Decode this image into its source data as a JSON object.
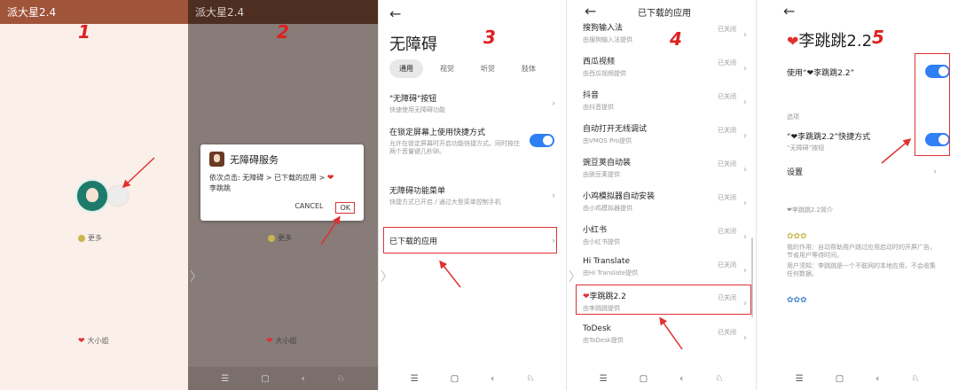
{
  "colors": {
    "accent": "#e03030",
    "switch": "#2f7ff5",
    "panel1_bar": "#a0543a",
    "panel2_bar": "#4d2e21"
  },
  "p1": {
    "step": "1",
    "app_title": "派大星2.4",
    "more": "更多",
    "footer": "大小姐"
  },
  "p2": {
    "step": "2",
    "app_title": "派大星2.4",
    "more": "更多",
    "footer": "大小姐",
    "dialog": {
      "title": "无障碍服务",
      "body_line1": "依次点击: 无障碍 > 已下载的应用 >",
      "body_line2": "李跳跳",
      "cancel": "CANCEL",
      "ok": "OK"
    },
    "nav": [
      "☰",
      "▢",
      "‹",
      "♘"
    ]
  },
  "p3": {
    "step": "3",
    "back": "←",
    "title": "无障碍",
    "tabs": [
      "通用",
      "视觉",
      "听觉",
      "肢体"
    ],
    "rows": [
      {
        "title": "\"无障碍\"按钮",
        "sub": "快速使用无障碍功能"
      },
      {
        "title": "在锁定屏幕上使用快捷方式",
        "sub": "允许在锁定屏幕时开启功能快捷方式。同时按住两个音量键几秒钟。"
      },
      {
        "title": "无障碍功能菜单",
        "sub": "快捷方式已开启 / 通过大型菜单控制手机"
      },
      {
        "title": "已下载的应用",
        "sub": ""
      }
    ],
    "nav": [
      "☰",
      "▢",
      "‹",
      "♘"
    ]
  },
  "p4": {
    "step": "4",
    "back": "←",
    "title": "已下载的应用",
    "apps": [
      {
        "name": "搜狗输入法",
        "sub": "由搜狗输入法提供",
        "status": "已关闭"
      },
      {
        "name": "西瓜视频",
        "sub": "由西瓜视频提供",
        "status": "已关闭"
      },
      {
        "name": "抖音",
        "sub": "由抖音提供",
        "status": "已关闭"
      },
      {
        "name": "自动打开无线调试",
        "sub": "由VMOS Pro提供",
        "status": "已关闭"
      },
      {
        "name": "豌豆荚自动装",
        "sub": "由豌豆荚提供",
        "status": "已关闭"
      },
      {
        "name": "小鸡模拟器自动安装",
        "sub": "由小鸡模拟器提供",
        "status": "已关闭"
      },
      {
        "name": "小红书",
        "sub": "由小红书提供",
        "status": "已关闭"
      },
      {
        "name": "Hi Translate",
        "sub": "由Hi Translate提供",
        "status": "已关闭"
      },
      {
        "name": "李跳跳2.2",
        "sub": "由李跳跳提供",
        "status": "已关闭"
      },
      {
        "name": "ToDesk",
        "sub": "由ToDesk提供",
        "status": "已关闭"
      }
    ],
    "nav": [
      "☰",
      "▢",
      "‹",
      "♘"
    ]
  },
  "p5": {
    "step": "5",
    "back": "←",
    "title": "李跳跳2.2",
    "use_label": "使用“❤李跳跳2.2”",
    "section": "选项",
    "shortcut_label": "“❤李跳跳2.2”快捷方式",
    "shortcut_sub": "“无障碍”按钮",
    "settings": "设置",
    "help_title": "❤李跳跳2.2简介",
    "help_lines": [
      "我的作用：自动帮助用户跳过应用启动时的开屏广告，节省用户等待时间。",
      "用户须知：李跳跳是一个不联网的本地应用，不会收集任何数据。"
    ],
    "nav": [
      "☰",
      "▢",
      "‹",
      "♘"
    ]
  }
}
